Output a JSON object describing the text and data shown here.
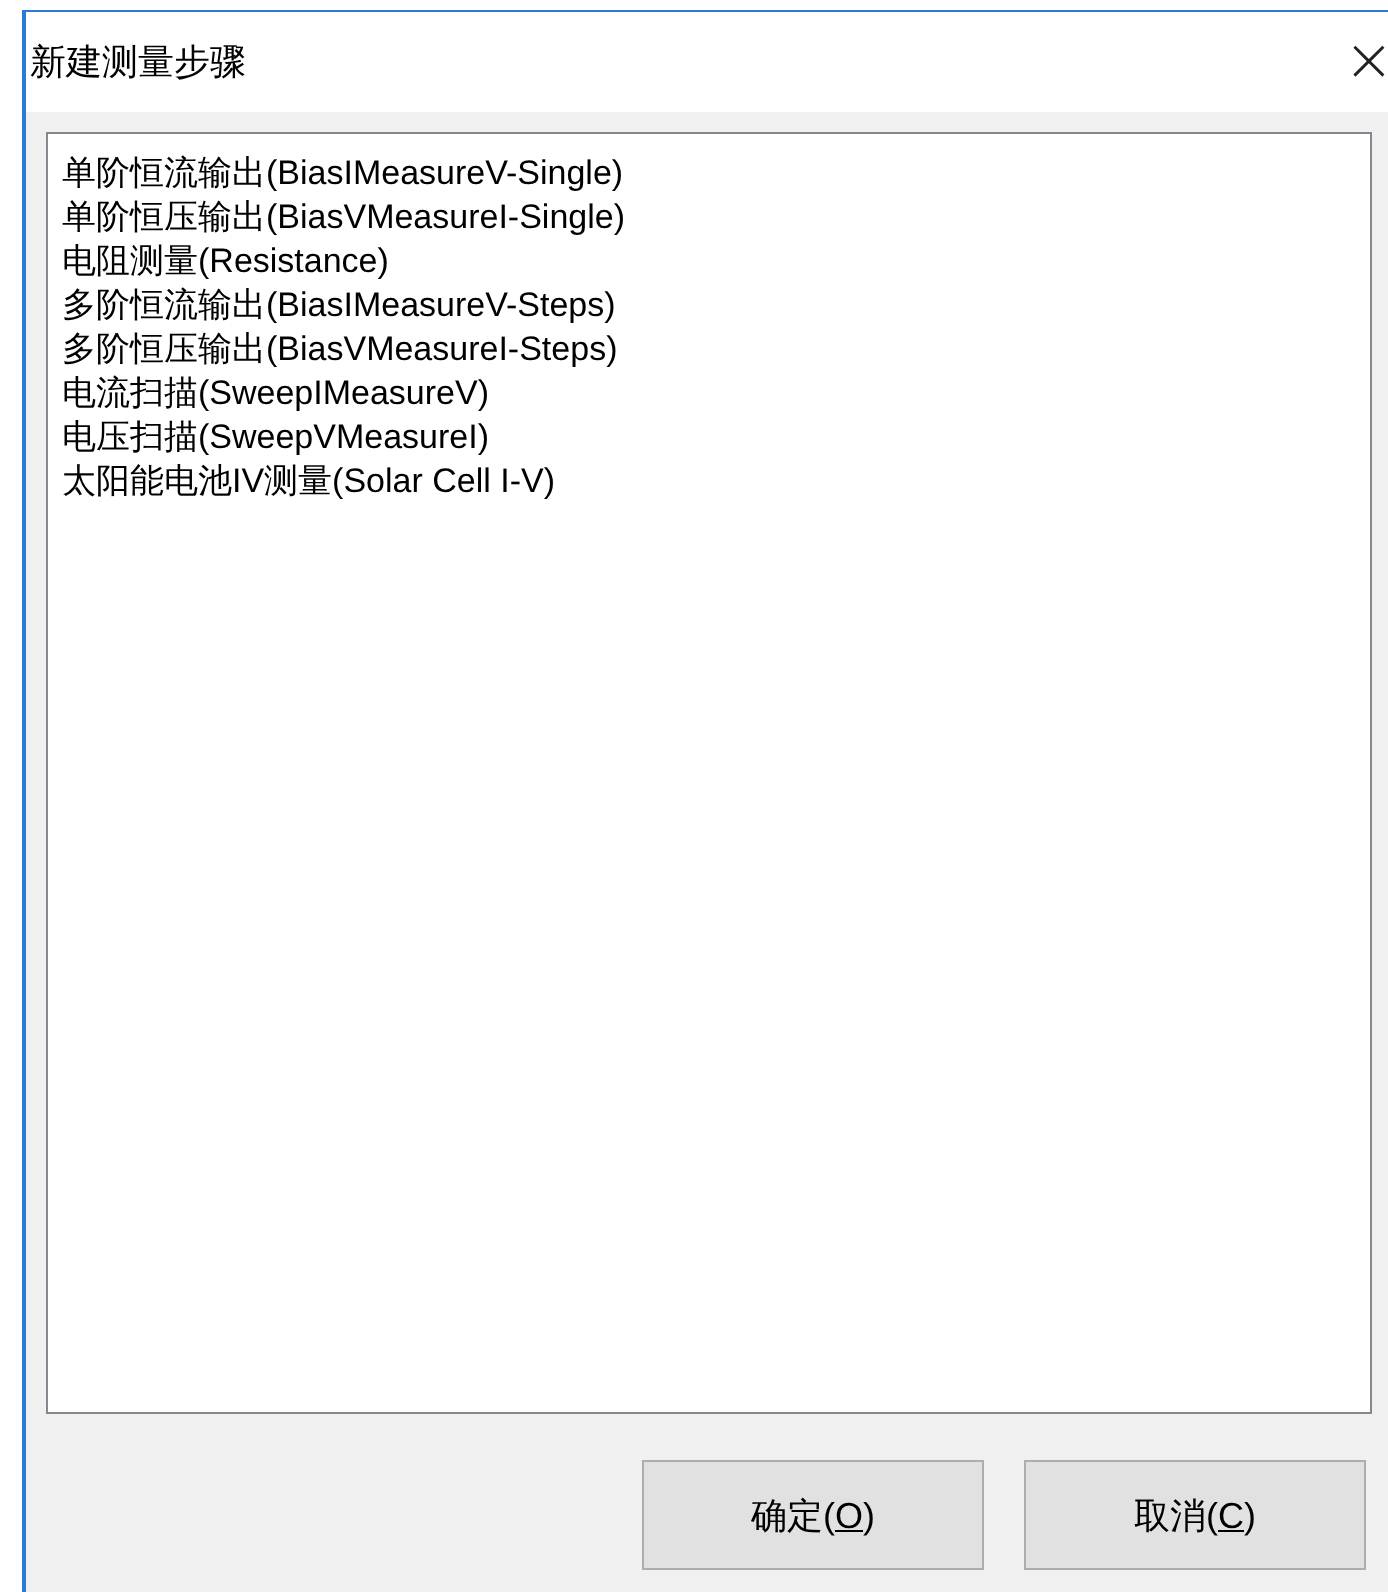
{
  "window": {
    "title": "新建测量步骤",
    "close": "×"
  },
  "list": {
    "items": [
      {
        "label": "单阶恒流输出(BiasIMeasureV-Single)",
        "selected": false
      },
      {
        "label": "单阶恒压输出(BiasVMeasureI-Single)",
        "selected": false
      },
      {
        "label": "电阻测量(Resistance)",
        "selected": false
      },
      {
        "label": "多阶恒流输出(BiasIMeasureV-Steps)",
        "selected": false
      },
      {
        "label": "多阶恒压输出(BiasVMeasureI-Steps)",
        "selected": false
      },
      {
        "label": "电流扫描(SweepIMeasureV)",
        "selected": false
      },
      {
        "label": "电压扫描(SweepVMeasureI)",
        "selected": false
      },
      {
        "label": "太阳能电池IV测量(Solar Cell I-V)",
        "selected": false
      }
    ]
  },
  "buttons": [
    {
      "before": "确定(",
      "access_key": "O",
      "after": ")"
    },
    {
      "before": "取消(",
      "access_key": "C",
      "after": ")"
    }
  ]
}
